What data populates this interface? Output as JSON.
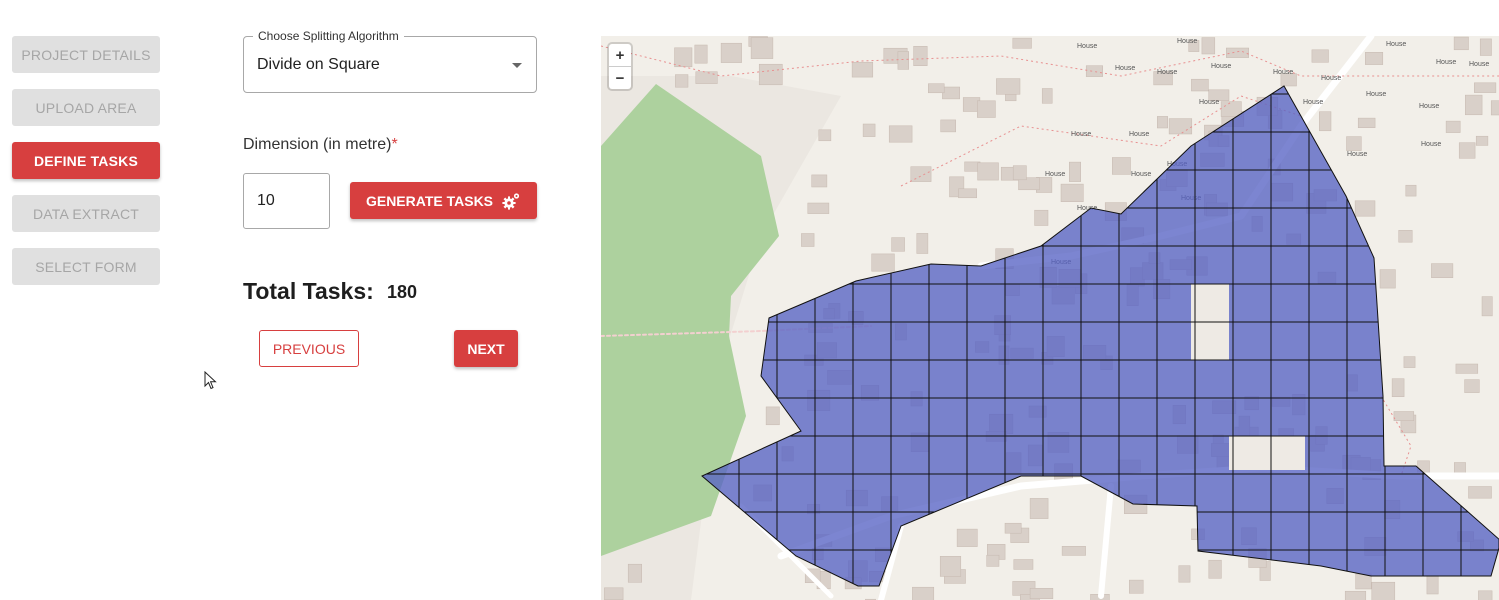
{
  "sidebar": {
    "steps": [
      {
        "label": "PROJECT DETAILS",
        "state": "inactive"
      },
      {
        "label": "UPLOAD AREA",
        "state": "inactive"
      },
      {
        "label": "DEFINE TASKS",
        "state": "active"
      },
      {
        "label": "DATA EXTRACT",
        "state": "inactive"
      },
      {
        "label": "SELECT FORM",
        "state": "inactive"
      }
    ]
  },
  "form": {
    "algorithm_legend": "Choose Splitting Algorithm",
    "algorithm_value": "Divide on Square",
    "dimension_label": "Dimension (in metre)",
    "dimension_required_mark": "*",
    "dimension_value": "10",
    "generate_label": "GENERATE TASKS",
    "total_label": "Total Tasks:",
    "total_value": "180",
    "previous_label": "PREVIOUS",
    "next_label": "NEXT"
  },
  "map": {
    "zoom_in": "+",
    "zoom_out": "−",
    "house_label": "House",
    "colors": {
      "task_fill": "#5763c4",
      "task_grid": "#111111",
      "forest": "#add19e",
      "building": "#d9d0c9",
      "road": "#ffffff"
    }
  },
  "colors": {
    "accent": "#d73f3f",
    "inactive_bg": "#e0e0e0",
    "inactive_text": "#a6a6a6"
  },
  "icons": {
    "generate": "gear-icon",
    "cursor": "mouse-pointer-icon"
  }
}
